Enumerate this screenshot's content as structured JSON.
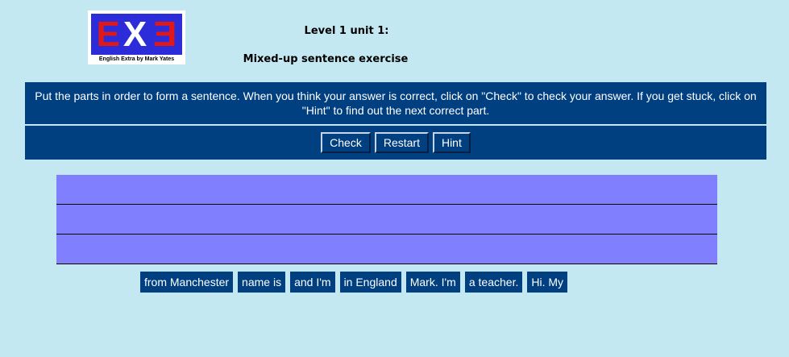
{
  "logo": {
    "letters": [
      "E",
      "X",
      "E"
    ],
    "caption": "English Extra by Mark Yates"
  },
  "header": {
    "level": "Level 1 unit 1:",
    "exercise": "Mixed-up sentence exercise"
  },
  "instructions": "Put the parts in order to form a sentence. When you think your answer is correct, click on \"Check\" to check your answer. If you get stuck, click on \"Hint\" to find out the next correct part.",
  "buttons": {
    "check": "Check",
    "restart": "Restart",
    "hint": "Hint"
  },
  "answer_slots": [
    "",
    "",
    ""
  ],
  "pieces": [
    "from Manchester",
    "name is",
    "and I'm",
    "in England",
    "Mark. I'm",
    "a teacher.",
    "Hi. My"
  ],
  "colors": {
    "background": "#c3e8f2",
    "panel": "#003f80",
    "slot": "#8080ff",
    "logo_letters": "#e01818",
    "logo_bg": "#2c2cd8"
  }
}
